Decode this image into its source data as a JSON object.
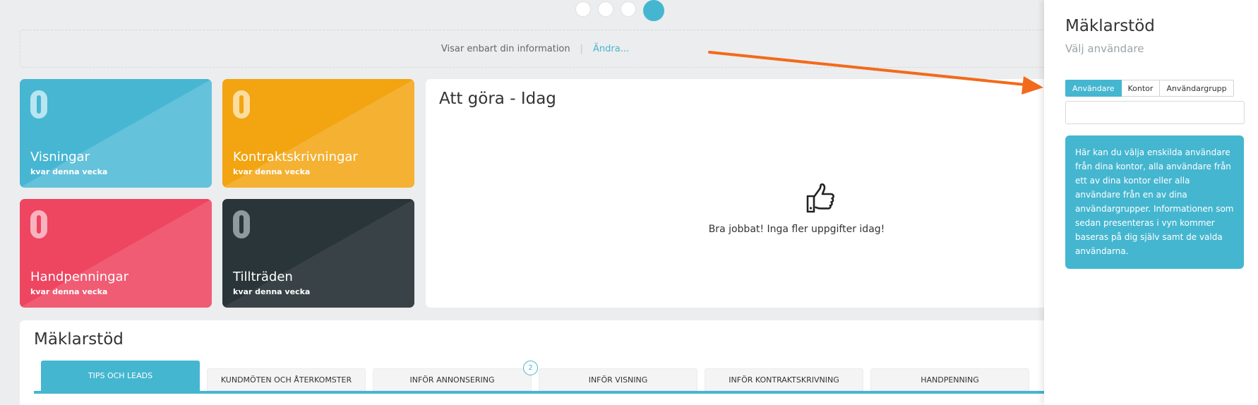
{
  "carousel": {
    "count": 4,
    "active_index": 3
  },
  "info_strip": {
    "text": "Visar enbart din information",
    "separator": "|",
    "change_link": "Ändra..."
  },
  "tiles": [
    {
      "value": "0",
      "title": "Visningar",
      "subtitle": "kvar denna vecka",
      "color": "#47b6d3"
    },
    {
      "value": "0",
      "title": "Kontraktskrivningar",
      "subtitle": "kvar denna vecka",
      "color": "#f2a411"
    },
    {
      "value": "0",
      "title": "Handpenningar",
      "subtitle": "kvar denna vecka",
      "color": "#ee4560"
    },
    {
      "value": "0",
      "title": "Tillträden",
      "subtitle": "kvar denna vecka",
      "color": "#2a3539"
    }
  ],
  "todo": {
    "title": "Att göra - Idag",
    "icon": "thumbs-up-icon",
    "empty_message": "Bra jobbat! Inga fler uppgifter idag!"
  },
  "maklarstod_panel": {
    "title": "Mäklarstöd",
    "tabs": [
      {
        "label": "TIPS OCH LEADS",
        "active": true
      },
      {
        "label": "KUNDMÖTEN OCH ÅTERKOMSTER"
      },
      {
        "label": "INFÖR ANNONSERING",
        "badge": "2"
      },
      {
        "label": "INFÖR VISNING"
      },
      {
        "label": "INFÖR KONTRAKTSKRIVNING"
      },
      {
        "label": "HANDPENNING"
      }
    ]
  },
  "side_panel": {
    "title": "Mäklarstöd",
    "subtitle": "Välj användare",
    "segments": [
      "Användare",
      "Kontor",
      "Användargrupp"
    ],
    "active_segment": "Användare",
    "search_value": "",
    "help_text": "Här kan du välja enskilda användare från dina kontor, alla användare från ett av dina kontor eller alla användare från en av dina användargrupper. Informationen som sedan presenteras i vyn kommer baseras på dig själv samt de valda användarna."
  },
  "colors": {
    "accent": "#45b6d0",
    "arrow": "#f26a1b"
  }
}
